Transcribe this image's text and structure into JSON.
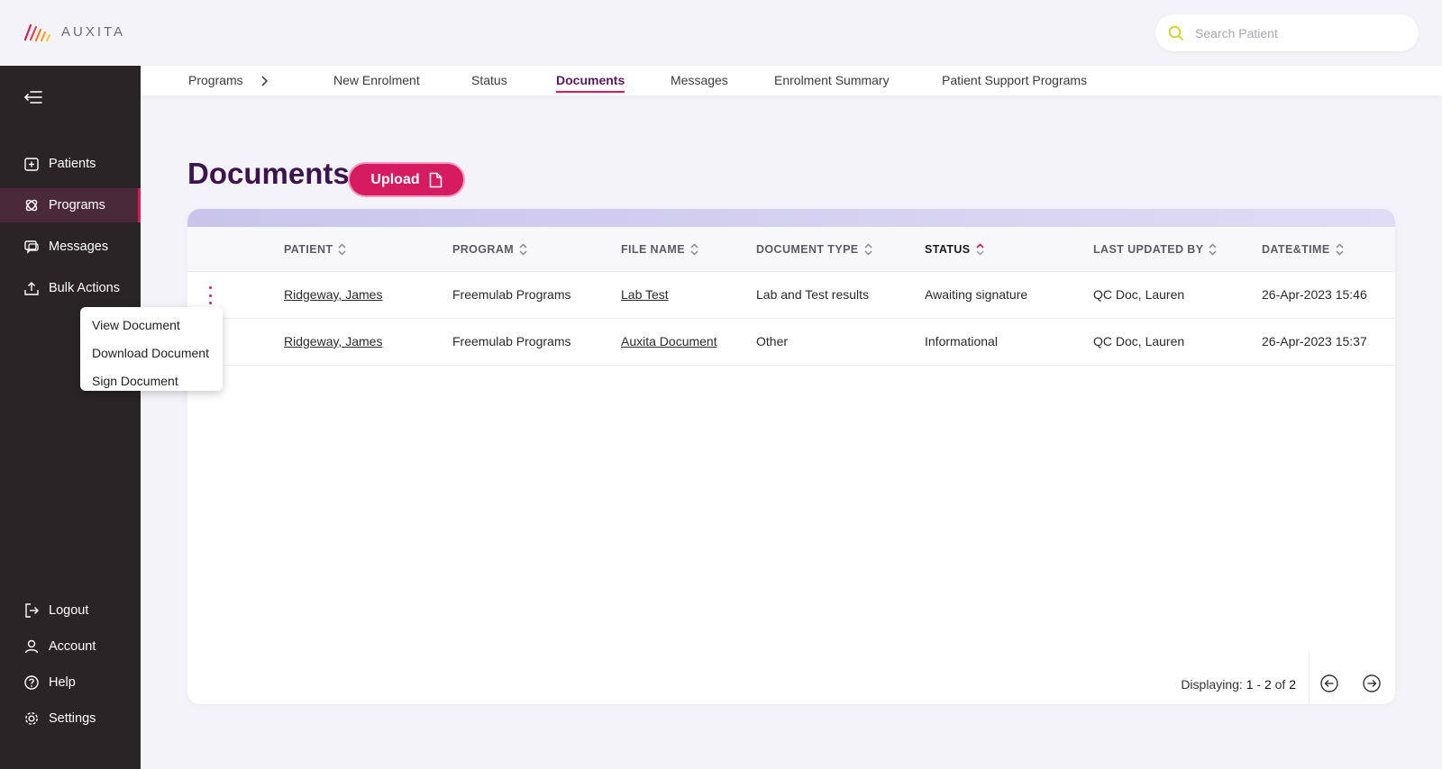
{
  "brand": {
    "name": "AUXITA",
    "accent": "#d41c5f",
    "title_color": "#3d1350"
  },
  "search": {
    "placeholder": "Search Patient",
    "value": ""
  },
  "sidebar": {
    "items": [
      {
        "label": "Patients",
        "icon": "patients-icon"
      },
      {
        "label": "Programs",
        "icon": "programs-icon",
        "active": true
      },
      {
        "label": "Messages",
        "icon": "messages-icon"
      },
      {
        "label": "Bulk Actions",
        "icon": "upload-icon"
      }
    ],
    "bottom": [
      {
        "label": "Logout",
        "icon": "logout-icon"
      },
      {
        "label": "Account",
        "icon": "account-icon"
      },
      {
        "label": "Help",
        "icon": "help-icon"
      },
      {
        "label": "Settings",
        "icon": "gear-icon"
      }
    ]
  },
  "tabs": {
    "breadcrumb": "Programs",
    "items": [
      "New Enrolment",
      "Status",
      "Documents",
      "Messages",
      "Enrolment Summary",
      "Patient Support Programs"
    ],
    "active": "Documents"
  },
  "page": {
    "title": "Documents",
    "upload_label": "Upload"
  },
  "table": {
    "columns": [
      "PATIENT",
      "PROGRAM",
      "FILE NAME",
      "DOCUMENT TYPE",
      "STATUS",
      "LAST UPDATED BY",
      "DATE&TIME"
    ],
    "sorted_column": "STATUS",
    "rows": [
      {
        "patient": "Ridgeway, James",
        "program": "Freemulab Programs",
        "file": "Lab Test",
        "type": "Lab and Test results",
        "status": "Awaiting signature",
        "updated_by": "QC Doc, Lauren",
        "datetime": "26-Apr-2023 15:46"
      },
      {
        "patient": "Ridgeway, James",
        "program": "Freemulab Programs",
        "file": "Auxita Document",
        "type": "Other",
        "status": "Informational",
        "updated_by": "QC Doc, Lauren",
        "datetime": "26-Apr-2023 15:37"
      }
    ]
  },
  "pagination": {
    "prefix": "Displaying:",
    "from": "1",
    "dash": "-",
    "to": "2",
    "of": "of",
    "total": "2"
  },
  "context_menu": {
    "items": [
      "View Document",
      "Download Document",
      "Sign Document"
    ]
  }
}
